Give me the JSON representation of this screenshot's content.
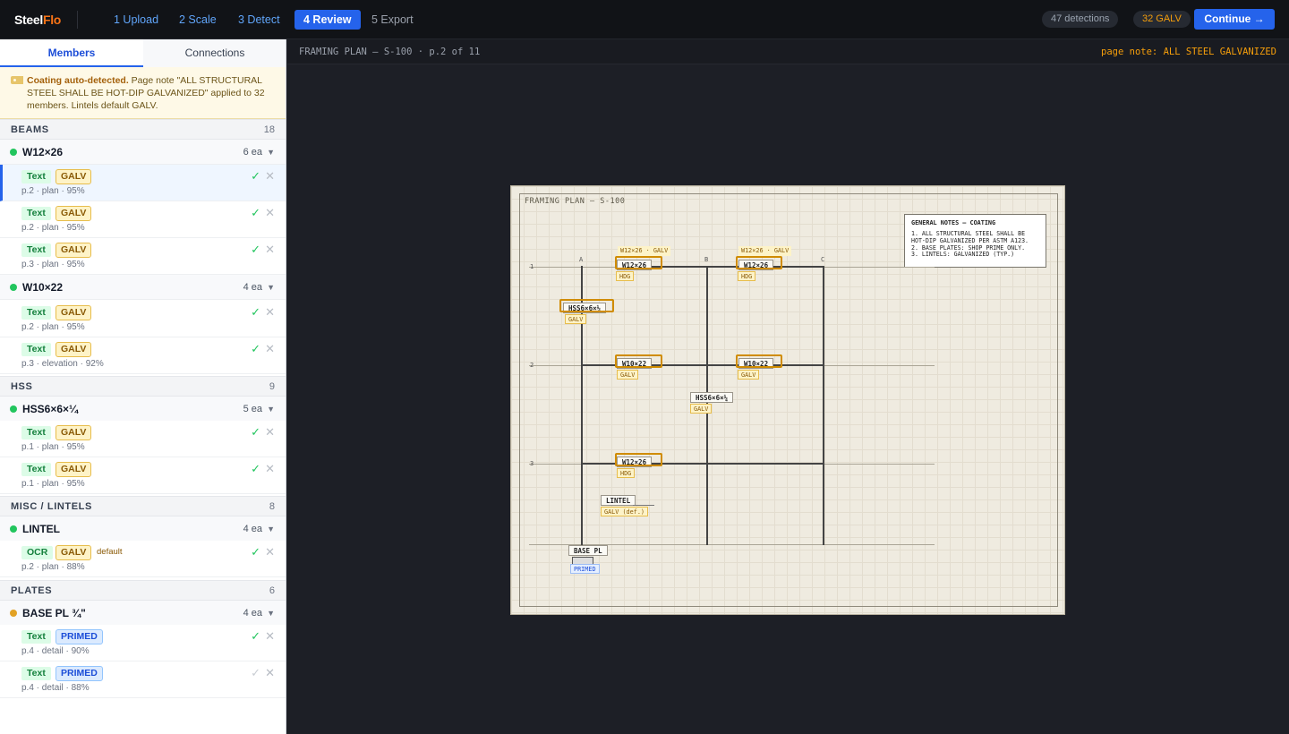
{
  "app": {
    "logo_a": "Steel",
    "logo_b": "Flo"
  },
  "steps": [
    "1 Upload",
    "2 Scale",
    "3 Detect",
    "4 Review",
    "5 Export"
  ],
  "header": {
    "detections": "47 detections",
    "galv": "32 GALV",
    "continue": "Continue →"
  },
  "tabs": [
    "Members",
    "Connections"
  ],
  "notice": {
    "title": "Coating auto-detected.",
    "body": " Page note \"ALL STRUCTURAL STEEL SHALL BE HOT-DIP GALVANIZED\" applied to 32 members. Lintels default GALV."
  },
  "sections": [
    {
      "name": "BEAMS",
      "count": "18"
    },
    {
      "name": "HSS",
      "count": "9"
    },
    {
      "name": "MISC / LINTELS",
      "count": "8"
    },
    {
      "name": "PLATES",
      "count": "6"
    }
  ],
  "groups": [
    {
      "name": "W12×26",
      "qty": "6 ea"
    },
    {
      "name": "W10×22",
      "qty": "4 ea"
    },
    {
      "name": "HSS6×6×¼",
      "qty": "5 ea"
    },
    {
      "name": "LINTEL",
      "qty": "4 ea"
    },
    {
      "name": "BASE PL ¾\"",
      "qty": "4 ea"
    }
  ],
  "rows": [
    {
      "source": "Text",
      "coating": "GALV",
      "meta": "p.2 · plan · 95%"
    },
    {
      "source": "Text",
      "coating": "GALV",
      "meta": "p.2 · plan · 95%"
    },
    {
      "source": "Text",
      "coating": "GALV",
      "meta": "p.3 · plan · 95%"
    },
    {
      "source": "Text",
      "coating": "GALV",
      "meta": "p.2 · plan · 95%"
    },
    {
      "source": "Text",
      "coating": "GALV",
      "meta": "p.3 · elevation · 92%"
    },
    {
      "source": "Text",
      "coating": "GALV",
      "meta": "p.1 · plan · 95%"
    },
    {
      "source": "Text",
      "coating": "GALV",
      "meta": "p.1 · plan · 95%"
    },
    {
      "source": "OCR",
      "coating": "GALV",
      "meta": "p.2 · plan · 88%",
      "note": "default"
    },
    {
      "source": "Text",
      "coating": "PRIMED",
      "meta": "p.4 · detail · 90%"
    },
    {
      "source": "Text",
      "coating": "PRIMED",
      "meta": "p.4 · detail · 88%"
    }
  ],
  "icons": {
    "accept": "✓",
    "reject": "✕",
    "expand": "▼"
  },
  "doc": {
    "title": "FRAMING PLAN — S-100 · p.2 of 11",
    "note": "page note: ALL STEEL GALVANIZED"
  },
  "sheet": {
    "title": "FRAMING PLAN — S-100",
    "notes_title": "GENERAL NOTES — COATING",
    "notes": [
      "1. ALL STRUCTURAL STEEL SHALL BE",
      "HOT-DIP GALVANIZED PER ASTM A123.",
      "2. BASE PLATES: SHOP PRIME ONLY.",
      "3. LINTELS: GALVANIZED (TYP.)"
    ],
    "grid_cols": [
      "A",
      "B",
      "C"
    ],
    "grid_rows": [
      "1",
      "2",
      "3"
    ],
    "labels": {
      "w12_a": "W12×26",
      "w12_b": "W12×26",
      "w12_c": "W12×26",
      "w10_a": "W10×22",
      "w10_b": "W10×22",
      "hss_a": "HSS6×6×¼",
      "hss_b": "HSS6×6×¼",
      "lintel": "LINTEL",
      "base_pl": "BASE PL"
    },
    "tags": {
      "top_a": "W12×26 · GALV",
      "top_b": "W12×26 · GALV",
      "hdg": "HDG",
      "galv": "GALV",
      "galv_def": "GALV (def.)",
      "primed": "PRIMED"
    }
  }
}
